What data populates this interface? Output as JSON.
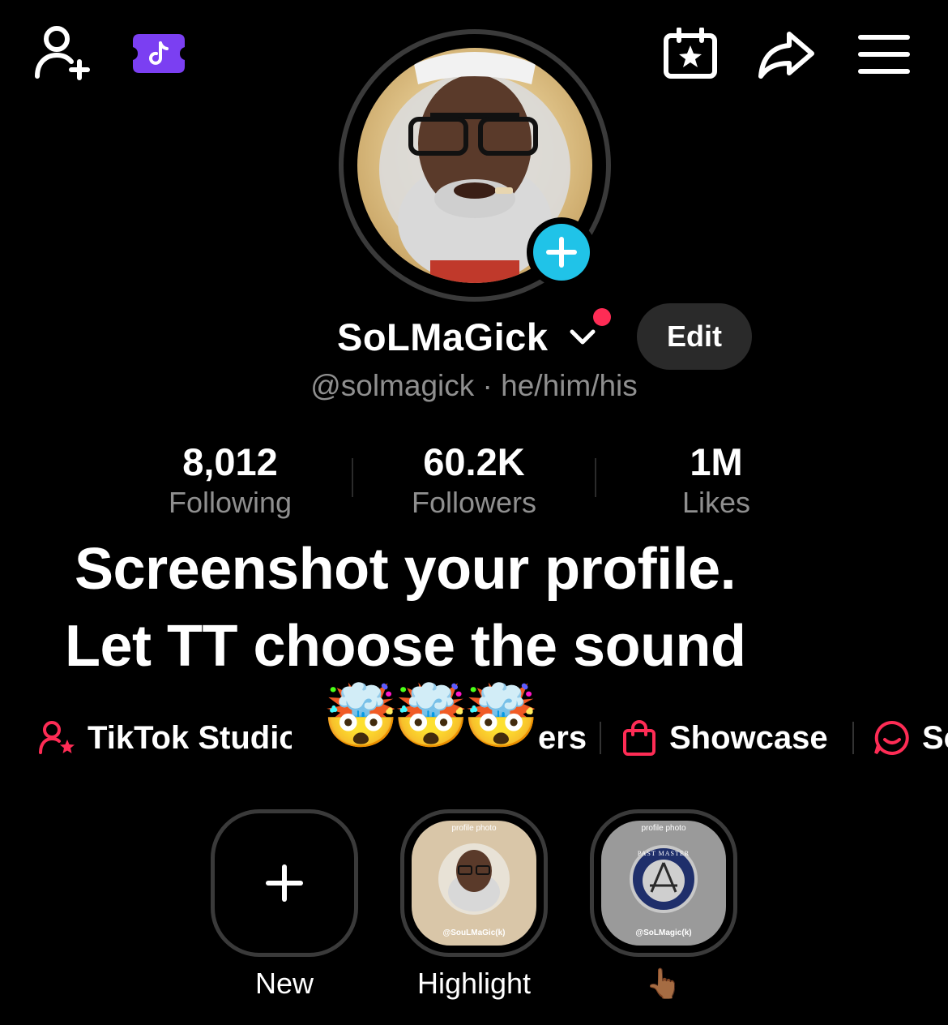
{
  "profile": {
    "display_name": "SoLMaGick",
    "handle_line": "@solmagick · he/him/his",
    "edit_label": "Edit"
  },
  "stats": [
    {
      "value": "8,012",
      "label": "Following"
    },
    {
      "value": "60.2K",
      "label": "Followers"
    },
    {
      "value": "1M",
      "label": "Likes"
    }
  ],
  "overlay": {
    "line1": "Screenshot your profile.",
    "line2": "Let TT choose the sound",
    "emojis": "🤯🤯🤯"
  },
  "chips": [
    {
      "label": "TikTok Studio",
      "icon": "user-star-icon"
    },
    {
      "label": "ers",
      "icon": "none"
    },
    {
      "label": "Showcase",
      "icon": "shopping-bag-icon"
    },
    {
      "label": "Sc",
      "icon": "chat-smile-icon"
    }
  ],
  "highlights": [
    {
      "label": "New"
    },
    {
      "label": "Highlight",
      "thumb_top": "profile photo",
      "thumb_bottom": "@SouLMaGic(k)"
    },
    {
      "label": "👆🏾",
      "thumb_top": "profile photo",
      "thumb_bottom": "@SoLMagic(k)",
      "seal_text": "PAST MASTER"
    }
  ],
  "colors": {
    "accent_pink": "#fe2c55",
    "badge_blue": "#20c3e8",
    "ticket_purple": "#7b3ff2"
  }
}
